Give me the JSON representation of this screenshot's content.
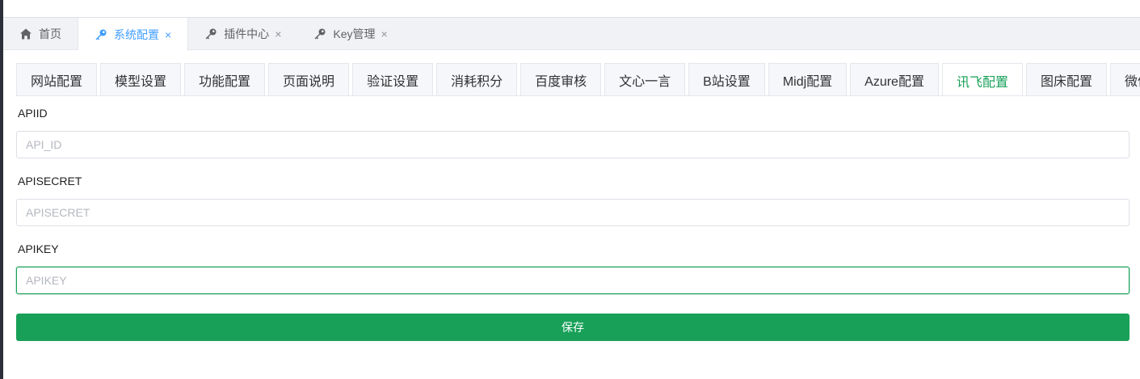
{
  "page_tabs": [
    {
      "label": "首页",
      "icon": "home-icon",
      "closable": false,
      "active": false
    },
    {
      "label": "系统配置",
      "icon": "key-icon",
      "closable": true,
      "active": true
    },
    {
      "label": "插件中心",
      "icon": "key-icon",
      "closable": true,
      "active": false
    },
    {
      "label": "Key管理",
      "icon": "key-icon",
      "closable": true,
      "active": false
    }
  ],
  "close_glyph": "×",
  "config_tabs": [
    "网站配置",
    "模型设置",
    "功能配置",
    "页面说明",
    "验证设置",
    "消耗积分",
    "百度审核",
    "文心一言",
    "B站设置",
    "Midj配置",
    "Azure配置",
    "讯飞配置",
    "图床配置",
    "微信"
  ],
  "active_config_tab": "讯飞配置",
  "form": {
    "fields": [
      {
        "label": "APIID",
        "placeholder": "API_ID",
        "value": ""
      },
      {
        "label": "APISECRET",
        "placeholder": "APISECRET",
        "value": ""
      },
      {
        "label": "APIKEY",
        "placeholder": "APIKEY",
        "value": ""
      }
    ],
    "save_label": "保存"
  },
  "colors": {
    "accent_blue": "#409eff",
    "accent_green": "#18a058"
  }
}
